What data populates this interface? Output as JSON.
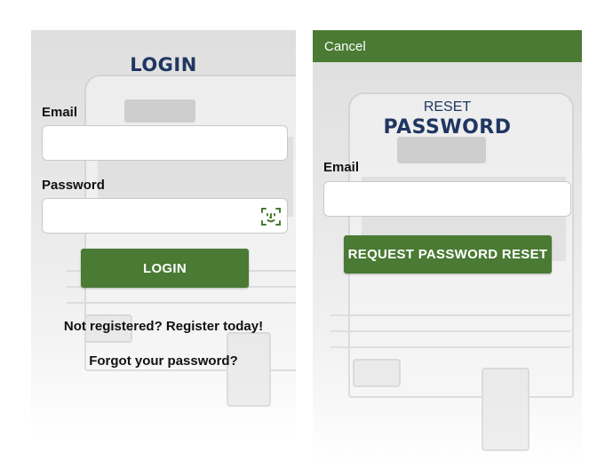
{
  "login": {
    "title": "LOGIN",
    "email_label": "Email",
    "email_value": "",
    "password_label": "Password",
    "password_value": "",
    "faceid_icon": "face-id-icon",
    "login_button": "LOGIN",
    "register_link": "Not registered? Register today!",
    "forgot_link": "Forgot your password?"
  },
  "reset": {
    "cancel": "Cancel",
    "title_small": "RESET",
    "title_big": "PASSWORD",
    "email_label": "Email",
    "email_value": "",
    "request_button": "REQUEST PASSWORD RESET"
  },
  "colors": {
    "brand_green": "#4a7a33",
    "title_navy": "#1f3661"
  }
}
